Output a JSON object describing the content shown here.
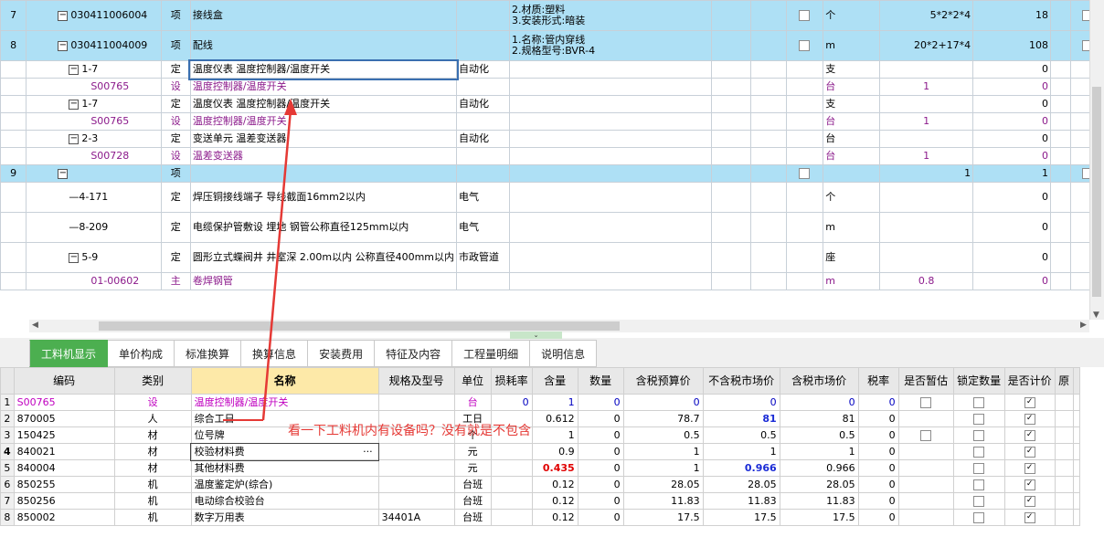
{
  "top_rows": [
    {
      "rownum": "7",
      "code": "030411006004",
      "type": "项",
      "name": "接线盒",
      "spec": "",
      "feature": "2.材质:塑料\n3.安装形式:暗装",
      "unit": "个",
      "qty_expr": "5*2*2*4",
      "qty": "18",
      "sel": true,
      "level": 0,
      "tree": "minus"
    },
    {
      "rownum": "8",
      "code": "030411004009",
      "type": "项",
      "name": "配线",
      "spec": "",
      "feature": "1.名称:管内穿线\n2.规格型号:BVR-4",
      "unit": "m",
      "qty_expr": "20*2+17*4",
      "qty": "108",
      "sel": true,
      "level": 0,
      "tree": "minus"
    },
    {
      "rownum": "",
      "code": "1-7",
      "type": "定",
      "name": "温度仪表 温度控制器/温度开关",
      "spec": "自动化",
      "feature": "",
      "unit": "支",
      "qty_expr": "",
      "qty": "0",
      "level": 1,
      "tree": "minus",
      "boxed": true
    },
    {
      "rownum": "",
      "code": "S00765",
      "type": "设",
      "name": "温度控制器/温度开关",
      "spec": "",
      "feature": "",
      "unit": "台",
      "qty_expr": "1",
      "qty": "0",
      "level": 2,
      "purple": true
    },
    {
      "rownum": "",
      "code": "1-7",
      "type": "定",
      "name": "温度仪表 温度控制器/温度开关",
      "spec": "自动化",
      "feature": "",
      "unit": "支",
      "qty_expr": "",
      "qty": "0",
      "level": 1,
      "tree": "minus"
    },
    {
      "rownum": "",
      "code": "S00765",
      "type": "设",
      "name": "温度控制器/温度开关",
      "spec": "",
      "feature": "",
      "unit": "台",
      "qty_expr": "1",
      "qty": "0",
      "level": 2,
      "purple": true
    },
    {
      "rownum": "",
      "code": "2-3",
      "type": "定",
      "name": "变送单元 温差变送器",
      "spec": "自动化",
      "feature": "",
      "unit": "台",
      "qty_expr": "",
      "qty": "0",
      "level": 1,
      "tree": "minus"
    },
    {
      "rownum": "",
      "code": "S00728",
      "type": "设",
      "name": "温差变送器",
      "spec": "",
      "feature": "",
      "unit": "台",
      "qty_expr": "1",
      "qty": "0",
      "level": 2,
      "purple": true
    },
    {
      "rownum": "9",
      "code": "",
      "type": "项",
      "name": "",
      "spec": "",
      "feature": "",
      "unit": "",
      "qty_expr": "1",
      "qty": "1",
      "sel": true,
      "level": 0,
      "tree": "minus"
    },
    {
      "rownum": "",
      "code": "4-171",
      "type": "定",
      "name": "焊压铜接线端子 导线截面16mm2以内",
      "spec": "电气",
      "feature": "",
      "unit": "个",
      "qty_expr": "",
      "qty": "0",
      "level": 1,
      "tall": true
    },
    {
      "rownum": "",
      "code": "8-209",
      "type": "定",
      "name": "电缆保护管敷设 埋地 钢管公称直径125mm以内",
      "spec": "电气",
      "feature": "",
      "unit": "m",
      "qty_expr": "",
      "qty": "0",
      "level": 1,
      "tall": true
    },
    {
      "rownum": "",
      "code": "5-9",
      "type": "定",
      "name": "圆形立式蝶阀井 井室深 2.00m以内 公称直径400mm以内",
      "spec": "市政管道",
      "feature": "",
      "unit": "座",
      "qty_expr": "",
      "qty": "0",
      "level": 1,
      "tree": "minus",
      "tall": true
    },
    {
      "rownum": "",
      "code": "01-00602",
      "type": "主",
      "name": "卷焊钢管",
      "spec": "",
      "feature": "",
      "unit": "m",
      "qty_expr": "0.8",
      "qty": "0",
      "level": 2,
      "purple": true
    }
  ],
  "tabs": [
    "工料机显示",
    "单价构成",
    "标准换算",
    "换算信息",
    "安装费用",
    "特征及内容",
    "工程量明细",
    "说明信息"
  ],
  "headers": [
    "编码",
    "类别",
    "名称",
    "规格及型号",
    "单位",
    "损耗率",
    "含量",
    "数量",
    "含税预算价",
    "不含税市场价",
    "含税市场价",
    "税率",
    "是否暂估",
    "锁定数量",
    "是否计价",
    "原"
  ],
  "rows": [
    {
      "n": "1",
      "code": "S00765",
      "cat": "设",
      "name": "温度控制器/温度开关",
      "spec": "",
      "unit": "台",
      "loss": "0",
      "content": "1",
      "qty": "0",
      "budget": "0",
      "mkt_ex": "0",
      "mkt_in": "0",
      "tax": "0",
      "pink": true
    },
    {
      "n": "2",
      "code": "870005",
      "cat": "人",
      "name": "综合工日",
      "spec": "",
      "unit": "工日",
      "loss": "",
      "content": "0.612",
      "qty": "0",
      "budget": "78.7",
      "mkt_ex": "81",
      "mkt_in": "81",
      "tax": "0"
    },
    {
      "n": "3",
      "code": "150425",
      "cat": "材",
      "name": "位号牌",
      "spec": "",
      "unit": "个",
      "loss": "",
      "content": "1",
      "qty": "0",
      "budget": "0.5",
      "mkt_ex": "0.5",
      "mkt_in": "0.5",
      "tax": "0"
    },
    {
      "n": "4",
      "code": "840021",
      "cat": "材",
      "name": "校验材料费",
      "spec": "",
      "unit": "元",
      "loss": "",
      "content": "0.9",
      "qty": "0",
      "budget": "1",
      "mkt_ex": "1",
      "mkt_in": "1",
      "tax": "0",
      "active": true
    },
    {
      "n": "5",
      "code": "840004",
      "cat": "材",
      "name": "其他材料费",
      "spec": "",
      "unit": "元",
      "loss": "",
      "content": "0.435",
      "qty": "0",
      "budget": "1",
      "mkt_ex": "0.966",
      "mkt_in": "0.966",
      "tax": "0"
    },
    {
      "n": "6",
      "code": "850255",
      "cat": "机",
      "name": "温度鉴定炉(综合)",
      "spec": "",
      "unit": "台班",
      "loss": "",
      "content": "0.12",
      "qty": "0",
      "budget": "28.05",
      "mkt_ex": "28.05",
      "mkt_in": "28.05",
      "tax": "0"
    },
    {
      "n": "7",
      "code": "850256",
      "cat": "机",
      "name": "电动综合校验台",
      "spec": "",
      "unit": "台班",
      "loss": "",
      "content": "0.12",
      "qty": "0",
      "budget": "11.83",
      "mkt_ex": "11.83",
      "mkt_in": "11.83",
      "tax": "0"
    },
    {
      "n": "8",
      "code": "850002",
      "cat": "机",
      "name": "数字万用表",
      "spec": "34401A",
      "unit": "台班",
      "loss": "",
      "content": "0.12",
      "qty": "0",
      "budget": "17.5",
      "mkt_ex": "17.5",
      "mkt_in": "17.5",
      "tax": "0"
    }
  ],
  "ellipsis": "···",
  "annotation": "看一下工料机内有设备吗？没有就是不包含",
  "colors": {
    "selected_row": "#aee0f5",
    "purple_text": "#8b1a8b",
    "active_tab": "#4caf50",
    "annotation": "#e53935",
    "header_highlight": "#fde9a8"
  }
}
